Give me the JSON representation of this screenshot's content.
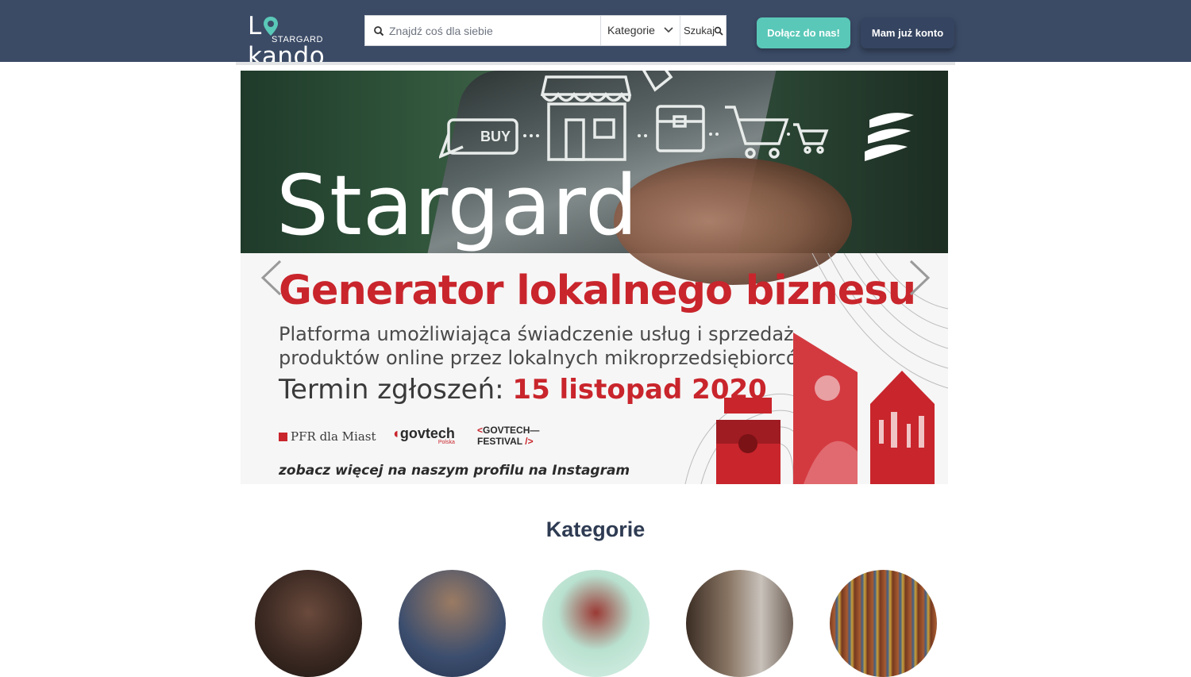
{
  "header": {
    "logo_text_before": "L",
    "logo_text_after": "kando",
    "logo_sub": "STARGARD",
    "search": {
      "placeholder": "Znajdź coś dla siebie",
      "category_label": "Kategorie",
      "button_label": "Szukaj"
    },
    "join_label": "Dołącz do nas!",
    "login_label": "Mam już konto",
    "colors": {
      "bar": "#3b4b66",
      "join": "#5ac8b8",
      "login": "#354460"
    }
  },
  "banner": {
    "city": "Stargard",
    "title": "Generator lokalnego biznesu",
    "subtitle_line1": "Platforma umożliwiająca świadczenie usług i sprzedaż",
    "subtitle_line2": "produktów online przez lokalnych mikroprzedsiębiorców",
    "deadline_label": "Termin zgłoszeń:",
    "deadline_date": "15 listopad 2020",
    "partner_pfr": "PFR dla Miast",
    "partner_govtech": "govtech",
    "partner_govtech_sub": "Polska",
    "partner_festival_line1": "GOVTECH",
    "partner_festival_line2": "FESTIVAL",
    "instagram_note": "zobacz więcej na naszym profilu na Instagram",
    "icon_buy_text": "BUY",
    "accent_color": "#c9252c"
  },
  "categories": {
    "heading": "Kategorie",
    "items": [
      {
        "icon": "coffee-image"
      },
      {
        "icon": "shopping-bags-image"
      },
      {
        "icon": "fruit-image"
      },
      {
        "icon": "interior-image"
      },
      {
        "icon": "bookshelf-image"
      }
    ]
  }
}
